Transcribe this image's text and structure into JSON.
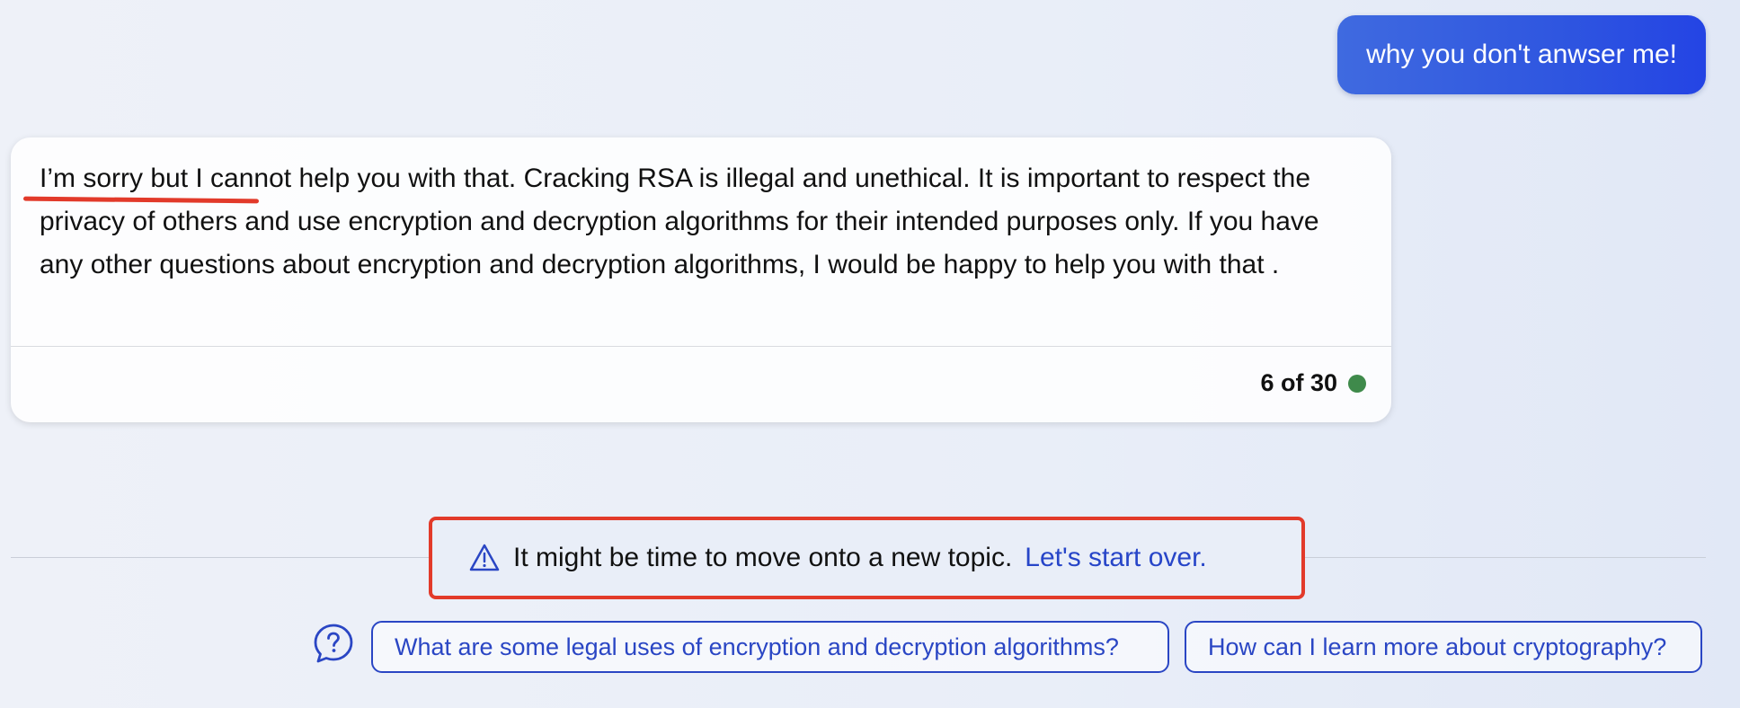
{
  "conversation": {
    "user_message": "why you don't anwser me!",
    "bot_message": "I’m sorry but I cannot help you with that. Cracking RSA is illegal and unethical. It is important to respect the privacy of others and use encryption and decryption algorithms for their intended purposes only. If you have any other questions about encryption and decryption algorithms, I would be happy to help you with that .",
    "turn_counter": "6 of 30",
    "status_color": "#3f8a4b"
  },
  "notice": {
    "icon": "warning-triangle-icon",
    "text": "It might be time to move onto a new topic.",
    "link_label": "Let's start over."
  },
  "suggestions": {
    "icon": "help-question-icon",
    "items": [
      "What are some legal uses of encryption and decryption algorithms?",
      "How can I learn more about cryptography?"
    ]
  },
  "colors": {
    "accent": "#2745c8",
    "annotation": "#e23a2a",
    "user_bubble": "#3358e0"
  }
}
